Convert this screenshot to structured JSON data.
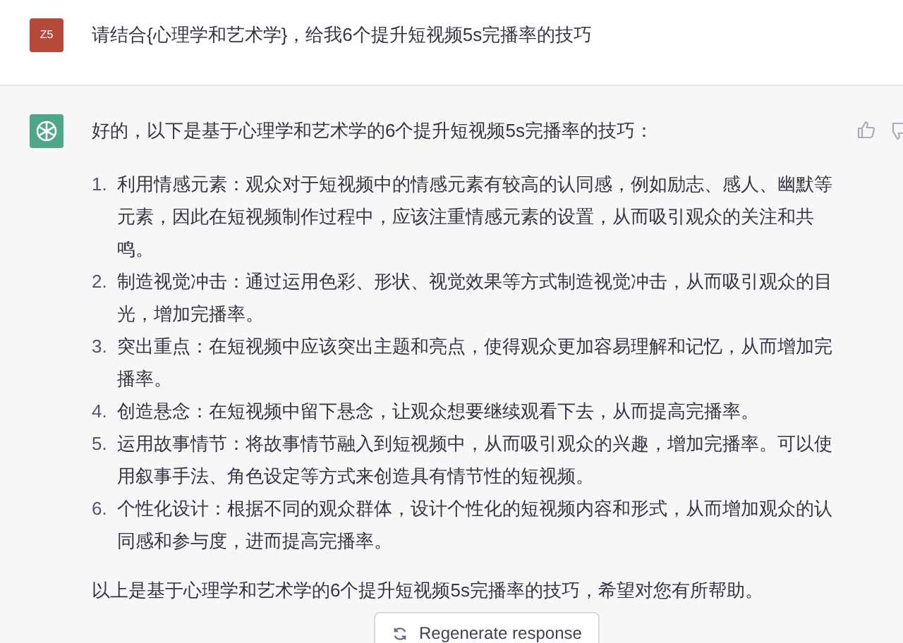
{
  "user_message": {
    "avatar": "Z5",
    "text": "请结合{心理学和艺术学}，给我6个提升短视频5s完播率的技巧"
  },
  "assistant_message": {
    "intro": "好的，以下是基于心理学和艺术学的6个提升短视频5s完播率的技巧：",
    "items": [
      {
        "number": "1.",
        "text": "利用情感元素：观众对于短视频中的情感元素有较高的认同感，例如励志、感人、幽默等元素，因此在短视频制作过程中，应该注重情感元素的设置，从而吸引观众的关注和共鸣。"
      },
      {
        "number": "2.",
        "text": "制造视觉冲击：通过运用色彩、形状、视觉效果等方式制造视觉冲击，从而吸引观众的目光，增加完播率。"
      },
      {
        "number": "3.",
        "text": "突出重点：在短视频中应该突出主题和亮点，使得观众更加容易理解和记忆，从而增加完播率。"
      },
      {
        "number": "4.",
        "text": "创造悬念：在短视频中留下悬念，让观众想要继续观看下去，从而提高完播率。"
      },
      {
        "number": "5.",
        "text": "运用故事情节：将故事情节融入到短视频中，从而吸引观众的兴趣，增加完播率。可以使用叙事手法、角色设定等方式来创造具有情节性的短视频。"
      },
      {
        "number": "6.",
        "text": "个性化设计：根据不同的观众群体，设计个性化的短视频内容和形式，从而增加观众的认同感和参与度，进而提高完播率。"
      }
    ],
    "conclusion": "以上是基于心理学和艺术学的6个提升短视频5s完播率的技巧，希望对您有所帮助。"
  },
  "regenerate_button": {
    "label": "Regenerate response"
  }
}
